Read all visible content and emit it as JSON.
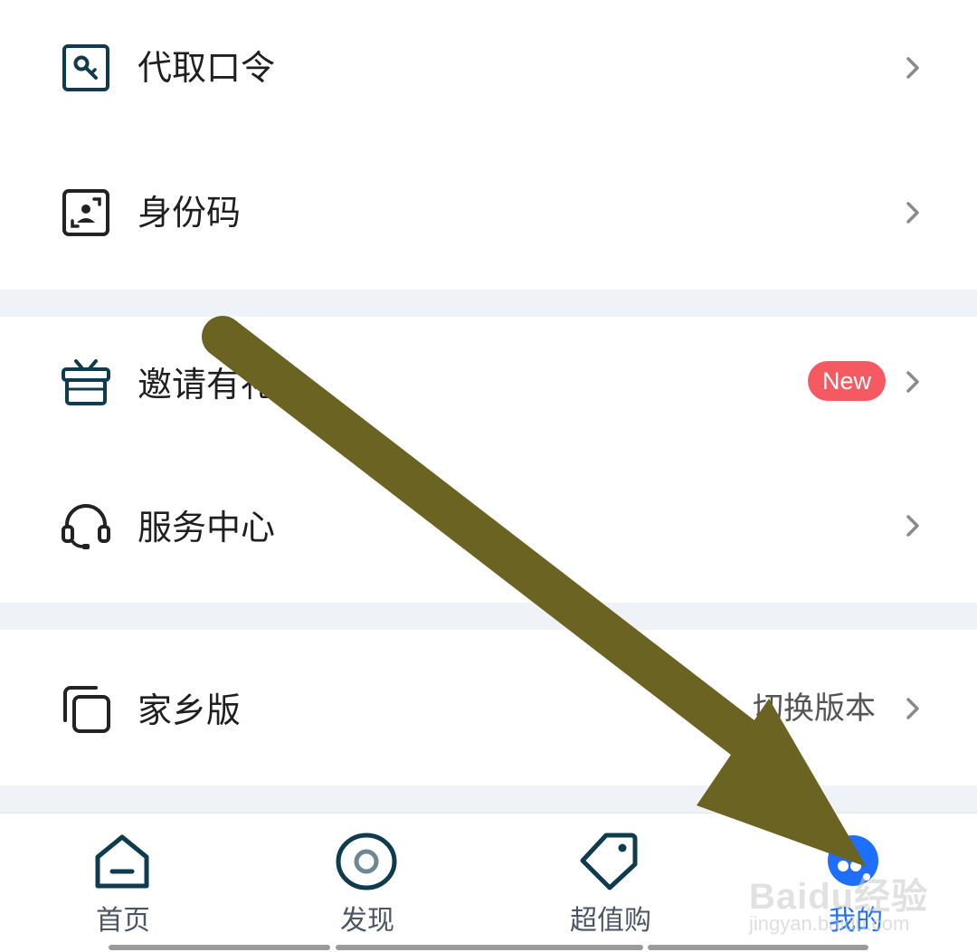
{
  "menu": {
    "items": [
      {
        "label": "代取口令",
        "icon": "key-search-icon"
      },
      {
        "label": "身份码",
        "icon": "id-scan-icon"
      },
      {
        "label": "邀请有礼",
        "icon": "gift-icon",
        "badge": "New"
      },
      {
        "label": "服务中心",
        "icon": "headset-icon"
      },
      {
        "label": "家乡版",
        "icon": "copy-layers-icon",
        "trailing_text": "切换版本"
      }
    ]
  },
  "tabbar": {
    "tabs": [
      {
        "label": "首页",
        "icon": "home-icon",
        "active": false
      },
      {
        "label": "发现",
        "icon": "eye-icon",
        "active": false
      },
      {
        "label": "超值购",
        "icon": "tag-icon",
        "active": false
      },
      {
        "label": "我的",
        "icon": "profile-mascot-icon",
        "active": true
      }
    ]
  },
  "watermark": {
    "main": "Baidu经验",
    "sub": "jingyan.baidu.com"
  },
  "colors": {
    "icon_stroke": "#0f3b4f",
    "active_tab": "#1f6fff",
    "badge": "#f55a63",
    "section_gap": "#eff3f8",
    "annotation_arrow": "#6b6322"
  }
}
